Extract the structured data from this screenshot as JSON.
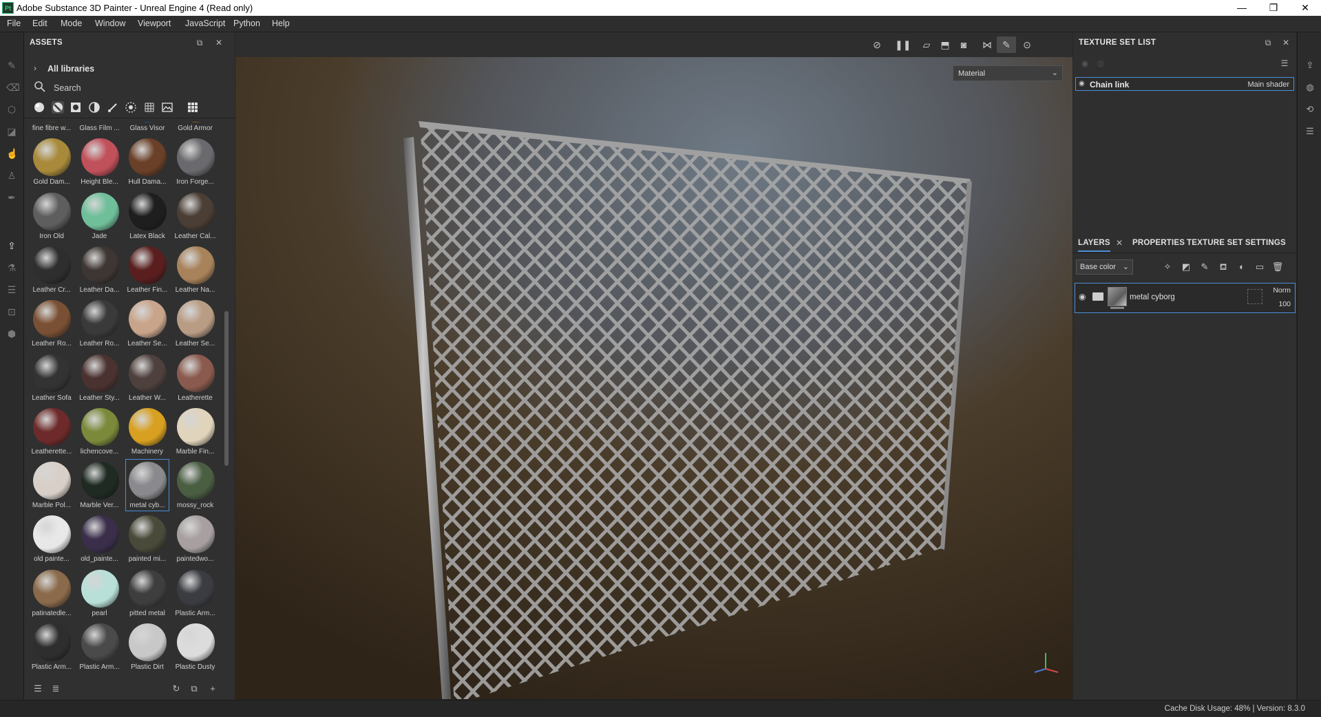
{
  "window": {
    "title": "Adobe Substance 3D Painter - Unreal Engine 4 (Read only)",
    "app_icon": "Pt",
    "controls": {
      "minimize": "—",
      "restore": "❐",
      "close": "✕"
    }
  },
  "menu": [
    "File",
    "Edit",
    "Mode",
    "Window",
    "Viewport",
    "JavaScript",
    "Python",
    "Help"
  ],
  "assets": {
    "title": "ASSETS",
    "libraries_label": "All libraries",
    "search_placeholder": "Search",
    "items": [
      {
        "label": "fine fibre w...",
        "color": "#7a5a3a"
      },
      {
        "label": "Glass Film ...",
        "color": "#4a4a4a"
      },
      {
        "label": "Glass Visor",
        "color": "#2f7ab0"
      },
      {
        "label": "Gold Armor",
        "color": "#b8922a"
      },
      {
        "label": "Gold Dam...",
        "color": "#a88a3a"
      },
      {
        "label": "Height Ble...",
        "color": "#c0505a"
      },
      {
        "label": "Hull Dama...",
        "color": "#6a4028"
      },
      {
        "label": "Iron Forge...",
        "color": "#6a6a6e"
      },
      {
        "label": "Iron Old",
        "color": "#5e5e5e"
      },
      {
        "label": "Jade",
        "color": "#6fbf9a"
      },
      {
        "label": "Latex Black",
        "color": "#1e1e1e"
      },
      {
        "label": "Leather Cal...",
        "color": "#4b3e34"
      },
      {
        "label": "Leather Cr...",
        "color": "#2e2e2e"
      },
      {
        "label": "Leather Da...",
        "color": "#3e3632"
      },
      {
        "label": "Leather Fin...",
        "color": "#5a1e1e"
      },
      {
        "label": "Leather Na...",
        "color": "#a8825a"
      },
      {
        "label": "Leather Ro...",
        "color": "#7a5034"
      },
      {
        "label": "Leather Ro...",
        "color": "#3a3a3a"
      },
      {
        "label": "Leather Se...",
        "color": "#c8a48a"
      },
      {
        "label": "Leather Se...",
        "color": "#b89c84"
      },
      {
        "label": "Leather Sofa",
        "color": "#333333"
      },
      {
        "label": "Leather Sty...",
        "color": "#4a3230"
      },
      {
        "label": "Leather W...",
        "color": "#4e403c"
      },
      {
        "label": "Leatherette",
        "color": "#8a5a4e"
      },
      {
        "label": "Leatherette...",
        "color": "#6e2a2a"
      },
      {
        "label": "lichencove...",
        "color": "#7a8a3a"
      },
      {
        "label": "Machinery",
        "color": "#d8a020"
      },
      {
        "label": "Marble Fin...",
        "color": "#e0d4bc"
      },
      {
        "label": "Marble Pol...",
        "color": "#d8d0c8"
      },
      {
        "label": "Marble Ver...",
        "color": "#1e2a22"
      },
      {
        "label": "metal cyb...",
        "color": "#8a8a8e"
      },
      {
        "label": "mossy_rock",
        "color": "#4a5e42"
      },
      {
        "label": "old painte...",
        "color": "#e8e8e8"
      },
      {
        "label": "old_painte...",
        "color": "#3a2e4a"
      },
      {
        "label": "painted mi...",
        "color": "#4a4a3a"
      },
      {
        "label": "paintedwo...",
        "color": "#a8a0a0"
      },
      {
        "label": "patinatedle...",
        "color": "#8a6a4a"
      },
      {
        "label": "pearl",
        "color": "#b8e0d8"
      },
      {
        "label": "pitted metal",
        "color": "#3e3e3e"
      },
      {
        "label": "Plastic Arm...",
        "color": "#3a3c42"
      },
      {
        "label": "Plastic Arm...",
        "color": "#2e2e2e"
      },
      {
        "label": "Plastic Arm...",
        "color": "#4a4a4a"
      },
      {
        "label": "Plastic Dirt",
        "color": "#c8c8c8"
      },
      {
        "label": "Plastic Dusty",
        "color": "#dcdcdc"
      }
    ],
    "selected_index": 30
  },
  "viewport": {
    "material_mode": "Material"
  },
  "texture_set_list": {
    "title": "TEXTURE SET LIST",
    "item": {
      "name": "Chain link",
      "shader": "Main shader"
    }
  },
  "layers": {
    "tabs": [
      "LAYERS",
      "PROPERTIES",
      "TEXTURE SET SETTINGS"
    ],
    "channel": "Base color",
    "layer": {
      "name": "metal cyborg",
      "blend": "Norm",
      "opacity": "100"
    }
  },
  "status": {
    "text": "Cache Disk Usage:   48% | Version: 8.3.0"
  },
  "accent_color": "#4a8fd9"
}
